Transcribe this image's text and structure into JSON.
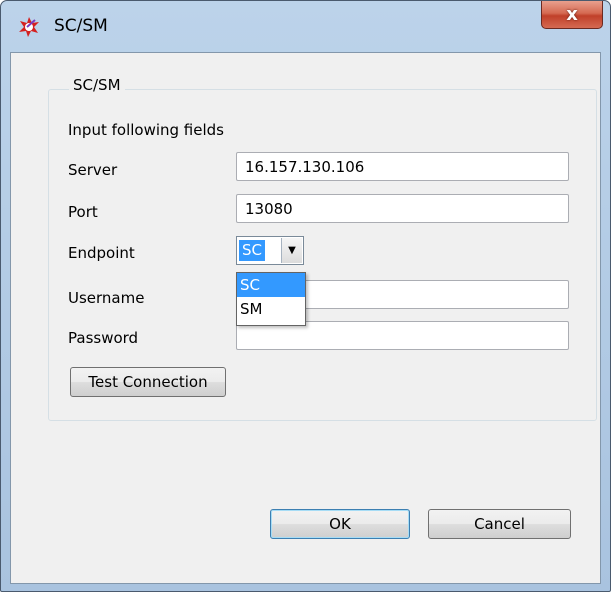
{
  "window": {
    "title": "SC/SM",
    "close_label": "x"
  },
  "group": {
    "title": "SC/SM",
    "instructions": "Input following fields"
  },
  "form": {
    "server_label": "Server",
    "server_value": "16.157.130.106",
    "port_label": "Port",
    "port_value": "13080",
    "endpoint_label": "Endpoint",
    "endpoint_value": "SC",
    "endpoint_options": [
      "SC",
      "SM"
    ],
    "username_label": "Username",
    "username_value": "",
    "password_label": "Password",
    "password_value": "",
    "test_connection_label": "Test Connection"
  },
  "footer": {
    "ok_label": "OK",
    "cancel_label": "Cancel"
  },
  "colors": {
    "selection": "#3399ff",
    "close_button": "#c0402a"
  }
}
